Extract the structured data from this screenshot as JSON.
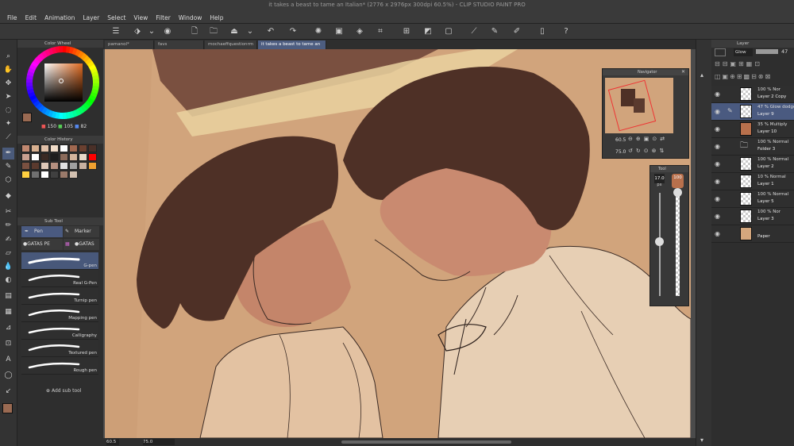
{
  "window": {
    "title": "it takes a beast to tame an Italian* (2776 x 2976px 300dpi 60.5%) - CLIP STUDIO PAINT PRO"
  },
  "menu": [
    "File",
    "Edit",
    "Animation",
    "Layer",
    "Select",
    "View",
    "Filter",
    "Window",
    "Help"
  ],
  "tabs": [
    "pamanol*",
    "favs",
    "mochaeffquestionrm",
    "it takes a beast to tame an Italian*"
  ],
  "color_wheel": {
    "panel_title": "Color Wheel",
    "r": "150",
    "g": "105",
    "b": "82"
  },
  "color_history": {
    "panel_title": "Color History",
    "swatches": [
      "#c08870",
      "#d8b090",
      "#e0c0a8",
      "#f0dcc8",
      "#ffffff",
      "#a06850",
      "#6a4030",
      "#4a3028",
      "#c8a090",
      "#ffffff",
      "#3a2a24",
      "#1e1e1e",
      "#8a6a5a",
      "#d4b49c",
      "#e8d8c8",
      "#ff0000",
      "#7a5040",
      "#5a3a2e",
      "#ddc8b8",
      "#b59080",
      "#e0e0e0",
      "#a0a0a0",
      "#c8b0a0",
      "#f0a030",
      "#ffd040",
      "#707070",
      "#ffffff",
      "#404040",
      "#9a7a6a",
      "#d2c0b0"
    ]
  },
  "subtool": {
    "panel_title": "Sub Tool",
    "tabs": [
      "Pen",
      "Marker",
      "●GATAS PE",
      "●GATAS PI"
    ],
    "brushes": [
      "G-pen",
      "Real G-Pen",
      "Turnip pen",
      "Mapping pen",
      "Calligraphy",
      "Textured pen",
      "Rough pen"
    ],
    "add_label": "Add sub tool"
  },
  "navigator": {
    "title": "Navigator",
    "zoom": "60.5",
    "angle": "75.0"
  },
  "brushsize": {
    "title": "Tool",
    "size": "17.0",
    "size_unit": "px",
    "opacity": "100"
  },
  "layers": {
    "panel_title": "Layer",
    "blend": "Glow",
    "opacity": "47",
    "items": [
      {
        "mode": "100 % Nor",
        "name": "Layer 2 Copy",
        "thumb": "checker"
      },
      {
        "mode": "47 % Glow dodge",
        "name": "Layer 9",
        "thumb": "checker",
        "selected": true
      },
      {
        "mode": "35 % Multiply",
        "name": "Layer 10",
        "thumb": "#b8704c"
      },
      {
        "mode": "100 % Normal",
        "name": "Folder 3",
        "thumb": "folder"
      },
      {
        "mode": "100 % Normal",
        "name": "Layer 2",
        "thumb": "checker"
      },
      {
        "mode": "10 % Normal",
        "name": "Layer 1",
        "thumb": "checker"
      },
      {
        "mode": "100 % Normal",
        "name": "Layer 5",
        "thumb": "checker"
      },
      {
        "mode": "100 % Nor",
        "name": "Layer 3",
        "thumb": "checker"
      },
      {
        "mode": "",
        "name": "Paper",
        "thumb": "#d4a77d"
      }
    ]
  },
  "status": {
    "zoom": "60.5",
    "angle": "75.0"
  },
  "colors": {
    "main": "#9a6a52",
    "sub": "#ffffff",
    "accent": "#4a5a80"
  }
}
